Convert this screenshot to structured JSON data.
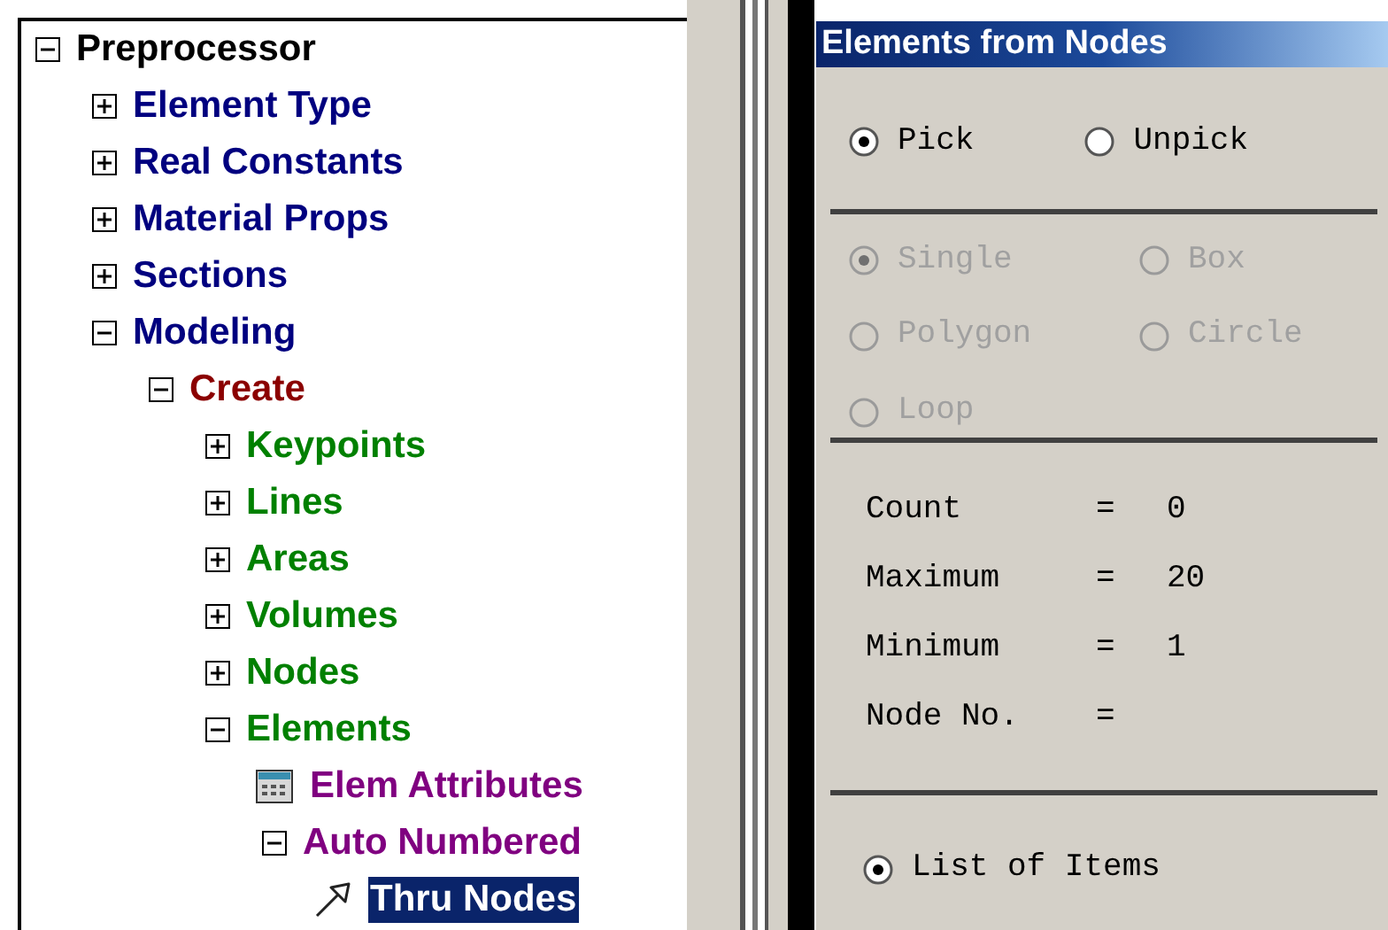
{
  "tree": [
    {
      "label": "Preprocessor",
      "kind": "folder",
      "expanded": true,
      "selected": false,
      "children": [
        {
          "label": "Element Type",
          "kind": "folder",
          "expanded": false,
          "selected": false
        },
        {
          "label": "Real Constants",
          "kind": "folder",
          "expanded": false,
          "selected": false
        },
        {
          "label": "Material Props",
          "kind": "folder",
          "expanded": false,
          "selected": false
        },
        {
          "label": "Sections",
          "kind": "folder",
          "expanded": false,
          "selected": false
        },
        {
          "label": "Modeling",
          "kind": "folder",
          "expanded": true,
          "selected": false,
          "children": [
            {
              "label": "Create",
              "kind": "folder",
              "expanded": true,
              "selected": false,
              "children": [
                {
                  "label": "Keypoints",
                  "kind": "folder",
                  "expanded": false,
                  "selected": false
                },
                {
                  "label": "Lines",
                  "kind": "folder",
                  "expanded": false,
                  "selected": false
                },
                {
                  "label": "Areas",
                  "kind": "folder",
                  "expanded": false,
                  "selected": false
                },
                {
                  "label": "Volumes",
                  "kind": "folder",
                  "expanded": false,
                  "selected": false
                },
                {
                  "label": "Nodes",
                  "kind": "folder",
                  "expanded": false,
                  "selected": false
                },
                {
                  "label": "Elements",
                  "kind": "folder",
                  "expanded": true,
                  "selected": false,
                  "children": [
                    {
                      "label": "Elem Attributes",
                      "kind": "dialog",
                      "selected": false
                    },
                    {
                      "label": "Auto Numbered",
                      "kind": "folder",
                      "expanded": true,
                      "selected": false,
                      "children": [
                        {
                          "label": "Thru Nodes",
                          "kind": "action",
                          "selected": true
                        }
                      ]
                    }
                  ]
                }
              ]
            }
          ]
        }
      ]
    }
  ],
  "dialog": {
    "title": "Elements from Nodes",
    "pick_mode": [
      {
        "label": "Pick",
        "selected": true
      },
      {
        "label": "Unpick",
        "selected": false
      }
    ],
    "pick_shape": [
      {
        "label": "Single",
        "selected": true,
        "disabled": true
      },
      {
        "label": "Box",
        "selected": false,
        "disabled": true
      },
      {
        "label": "Polygon",
        "selected": false,
        "disabled": true
      },
      {
        "label": "Circle",
        "selected": false,
        "disabled": true
      },
      {
        "label": "Loop",
        "selected": false,
        "disabled": true
      }
    ],
    "stats": [
      {
        "label": "Count",
        "sign": "=",
        "value": "0"
      },
      {
        "label": "Maximum",
        "sign": "=",
        "value": "20"
      },
      {
        "label": "Minimum",
        "sign": "=",
        "value": "1"
      },
      {
        "label": "Node No.",
        "sign": "="
      }
    ],
    "list_option": {
      "label": "List of Items",
      "selected": true
    }
  }
}
